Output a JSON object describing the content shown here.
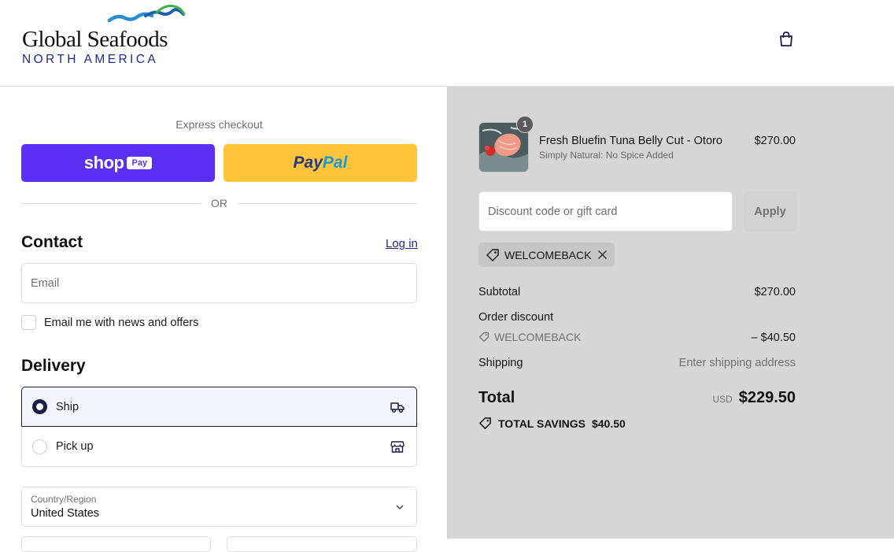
{
  "brand": {
    "name": "Global Seafoods",
    "subtitle": "NORTH AMERICA"
  },
  "header": {
    "cart_icon": "shopping-bag-icon"
  },
  "express": {
    "label": "Express checkout",
    "shop_word": "shop",
    "shop_pay_badge": "Pay",
    "paypal_part1": "Pay",
    "paypal_part2": "Pal",
    "or": "OR"
  },
  "contact": {
    "title": "Contact",
    "login": "Log in",
    "email_placeholder": "Email",
    "newsletter_label": "Email me with news and offers"
  },
  "delivery": {
    "title": "Delivery",
    "options": [
      {
        "label": "Ship",
        "icon": "truck-icon",
        "selected": true
      },
      {
        "label": "Pick up",
        "icon": "store-icon",
        "selected": false
      }
    ],
    "country_label": "Country/Region",
    "country_value": "United States"
  },
  "summary": {
    "item": {
      "name": "Fresh Bluefin Tuna Belly Cut - Otoro",
      "variant": "Simply Natural: No Spice Added",
      "price": "$270.00",
      "quantity": "1"
    },
    "discount_placeholder": "Discount code or gift card",
    "apply": "Apply",
    "applied_code": "WELCOMEBACK",
    "subtotal_label": "Subtotal",
    "subtotal_value": "$270.00",
    "order_discount_label": "Order discount",
    "discount_code": "WELCOMEBACK",
    "discount_value": "– $40.50",
    "shipping_label": "Shipping",
    "shipping_value": "Enter shipping address",
    "total_label": "Total",
    "currency": "USD",
    "total_value": "$229.50",
    "savings_label": "TOTAL SAVINGS",
    "savings_value": "$40.50"
  },
  "colors": {
    "shop_pay": "#5a31f4",
    "paypal": "#ffc439",
    "accent": "#1d2a8f",
    "summary_bg": "#d6d6d6"
  }
}
